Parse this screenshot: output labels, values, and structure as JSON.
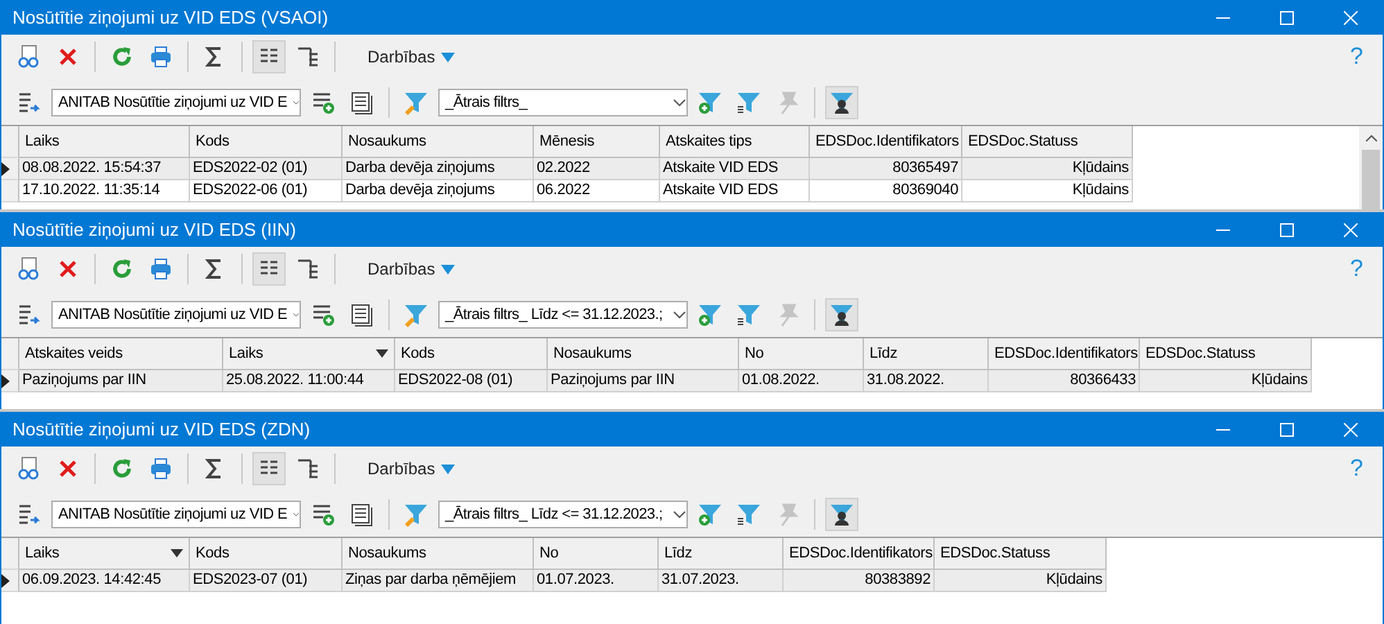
{
  "windows": [
    {
      "title": "Nosūtītie ziņojumi uz VID EDS (VSAOI)",
      "actions_menu": "Darbības",
      "help": "?",
      "grid_view_pressed": true,
      "layout_combo": "ANITAB Nosūtītie ziņojumi uz VID E",
      "filter_combo": "_Ātrais filtrs_",
      "user_filter_on": true,
      "clear_filter_disabled": true,
      "scrollbar": true,
      "columns": [
        {
          "label": "Laiks",
          "sorted": false
        },
        {
          "label": "Kods",
          "sorted": false
        },
        {
          "label": "Nosaukums",
          "sorted": false
        },
        {
          "label": "Mēnesis",
          "sorted": false
        },
        {
          "label": "Atskaites tips",
          "sorted": false
        },
        {
          "label": "EDSDoc.Identifikators",
          "sorted": false
        },
        {
          "label": "EDSDoc.Statuss",
          "sorted": false
        }
      ],
      "rows": [
        {
          "current": true,
          "cells": [
            "08.08.2022. 15:54:37",
            "EDS2022-02 (01)",
            "Darba devēja ziņojums",
            "02.2022",
            "Atskaite VID EDS",
            "80365497",
            "Kļūdains"
          ]
        },
        {
          "current": false,
          "cells": [
            "17.10.2022. 11:35:14",
            "EDS2022-06 (01)",
            "Darba devēja ziņojums",
            "06.2022",
            "Atskaite VID EDS",
            "80369040",
            "Kļūdains"
          ]
        }
      ]
    },
    {
      "title": "Nosūtītie ziņojumi uz VID EDS (IIN)",
      "actions_menu": "Darbības",
      "help": "?",
      "grid_view_pressed": true,
      "layout_combo": "ANITAB Nosūtītie ziņojumi uz VID E",
      "filter_combo": "_Ātrais filtrs_ Līdz <= 31.12.2023.;",
      "user_filter_on": true,
      "clear_filter_disabled": true,
      "scrollbar": false,
      "columns": [
        {
          "label": "Atskaites veids",
          "sorted": false
        },
        {
          "label": "Laiks",
          "sorted": true
        },
        {
          "label": "Kods",
          "sorted": false
        },
        {
          "label": "Nosaukums",
          "sorted": false
        },
        {
          "label": "No",
          "sorted": false
        },
        {
          "label": "Līdz",
          "sorted": false
        },
        {
          "label": "EDSDoc.Identifikators",
          "sorted": false
        },
        {
          "label": "EDSDoc.Statuss",
          "sorted": false
        }
      ],
      "rows": [
        {
          "current": true,
          "cells": [
            "Paziņojums par IIN",
            "25.08.2022. 11:00:44",
            "EDS2022-08 (01)",
            "Paziņojums par IIN",
            "01.08.2022.",
            "31.08.2022.",
            "80366433",
            "Kļūdains"
          ]
        }
      ]
    },
    {
      "title": "Nosūtītie ziņojumi uz VID EDS (ZDN)",
      "actions_menu": "Darbības",
      "help": "?",
      "grid_view_pressed": true,
      "layout_combo": "ANITAB Nosūtītie ziņojumi uz VID E",
      "filter_combo": "_Ātrais filtrs_ Līdz <= 31.12.2023.;",
      "user_filter_on": true,
      "clear_filter_disabled": true,
      "scrollbar": false,
      "columns": [
        {
          "label": "Laiks",
          "sorted": true
        },
        {
          "label": "Kods",
          "sorted": false
        },
        {
          "label": "Nosaukums",
          "sorted": false
        },
        {
          "label": "No",
          "sorted": false
        },
        {
          "label": "Līdz",
          "sorted": false
        },
        {
          "label": "EDSDoc.Identifikators",
          "sorted": false
        },
        {
          "label": "EDSDoc.Statuss",
          "sorted": false
        }
      ],
      "rows": [
        {
          "current": true,
          "cells": [
            "06.09.2023. 14:42:45",
            "EDS2023-07 (01)",
            "Ziņas par darba ņēmējiem",
            "01.07.2023.",
            "31.07.2023.",
            "80383892",
            "Kļūdains"
          ]
        }
      ]
    }
  ]
}
